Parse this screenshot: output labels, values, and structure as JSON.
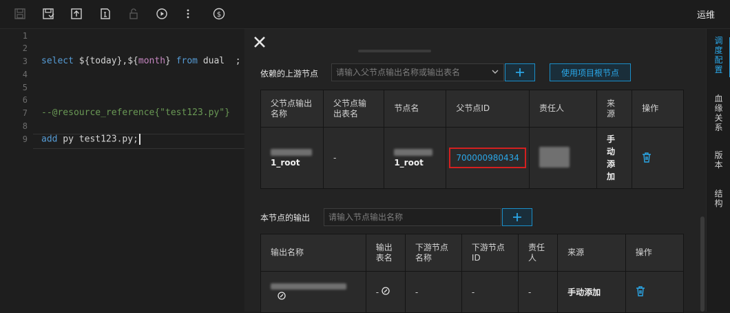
{
  "toolbar": {
    "icons": [
      "save-icon",
      "save-as-icon",
      "upload-icon",
      "format-icon",
      "lock-icon",
      "run-icon",
      "more-icon",
      "cost-icon"
    ],
    "right_label": "运维"
  },
  "editor": {
    "line_numbers": [
      "1",
      "2",
      "3",
      "4",
      "5",
      "6",
      "7",
      "8",
      "9"
    ],
    "line3": {
      "a": "select",
      "b": " ${today},${",
      "c": "month",
      "d": "} ",
      "e": "from",
      "f": " dual  ;"
    },
    "line7": "--@resource_reference{\"test123.py\"}",
    "line9": {
      "a": "add",
      "b": " py test123.py;"
    }
  },
  "upstream": {
    "label": "依赖的上游节点",
    "placeholder": "请输入父节点输出名称或输出表名",
    "use_root_label": "使用项目根节点",
    "headers": [
      "父节点输出名称",
      "父节点输出表名",
      "节点名",
      "父节点ID",
      "责任人",
      "来源",
      "操作"
    ],
    "row": {
      "output_name": "1_root",
      "table_name": "-",
      "node_name": "1_root",
      "parent_id": "700000980434",
      "source": "手动添加"
    }
  },
  "output": {
    "label": "本节点的输出",
    "placeholder": "请输入节点输出名称",
    "headers": [
      "输出名称",
      "输出表名",
      "下游节点名称",
      "下游节点ID",
      "责任人",
      "来源",
      "操作"
    ],
    "row": {
      "table_name": "-",
      "downstream_name": "-",
      "downstream_id": "-",
      "owner": "-",
      "source": "手动添加"
    }
  },
  "right_tabs": [
    {
      "label": "调度配置",
      "active": true
    },
    {
      "label": "血缘关系",
      "active": false
    },
    {
      "label": "版本",
      "active": false
    },
    {
      "label": "结构",
      "active": false
    }
  ],
  "colors": {
    "accent": "#2aa7e8",
    "highlight": "#d42020"
  }
}
